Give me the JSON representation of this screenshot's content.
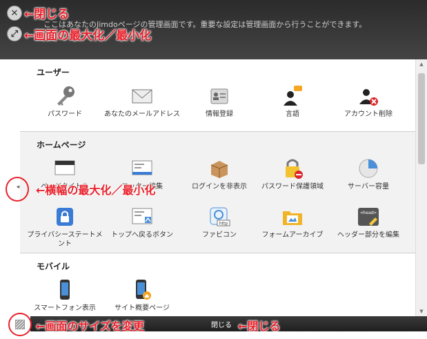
{
  "header": {
    "description": "ここはあなたのJimdoページの管理画面です。重要な設定は管理画面から行うことができます。"
  },
  "annotations": {
    "close_top": "←閉じる",
    "maximize": "←画面の最大化／最小化",
    "width_toggle": "←横幅の最大化／最小化",
    "resize": "←画面のサイズを変更",
    "close_bottom": "←閉じる"
  },
  "sections": {
    "user": {
      "title": "ユーザー",
      "items": [
        {
          "label": "パスワード",
          "icon": "key-icon"
        },
        {
          "label": "あなたのメールアドレス",
          "icon": "envelope-icon"
        },
        {
          "label": "情報登録",
          "icon": "id-card-icon"
        },
        {
          "label": "言語",
          "icon": "user-speech-icon"
        },
        {
          "label": "アカウント削除",
          "icon": "user-delete-icon"
        }
      ]
    },
    "homepage": {
      "title": "ホームページ",
      "items": [
        {
          "label": "ページタイトル",
          "icon": "page-title-icon"
        },
        {
          "label": "フッター編集",
          "icon": "footer-edit-icon"
        },
        {
          "label": "ログインを非表示",
          "icon": "box-icon"
        },
        {
          "label": "パスワード保護領域",
          "icon": "lock-delete-icon"
        },
        {
          "label": "サーバー容量",
          "icon": "pie-chart-icon"
        },
        {
          "label": "プライバシーステートメント",
          "icon": "padlock-icon"
        },
        {
          "label": "トップへ戻るボタン",
          "icon": "back-to-top-icon"
        },
        {
          "label": "ファビコン",
          "icon": "favicon-icon",
          "tag": "http"
        },
        {
          "label": "フォームアーカイブ",
          "icon": "folder-archive-icon"
        },
        {
          "label": "ヘッダー部分を編集",
          "icon": "head-tag-icon",
          "tag": "<head>"
        }
      ]
    },
    "mobile": {
      "title": "モバイル",
      "items": [
        {
          "label": "スマートフォン表示",
          "icon": "smartphone-icon"
        },
        {
          "label": "サイト概要ページ",
          "icon": "site-summary-icon"
        }
      ]
    }
  },
  "footer": {
    "close_label": "閉じる"
  },
  "colors": {
    "annotation": "#e8202a",
    "header_bg": "#333333",
    "section_tint": "#f2f2f2"
  }
}
